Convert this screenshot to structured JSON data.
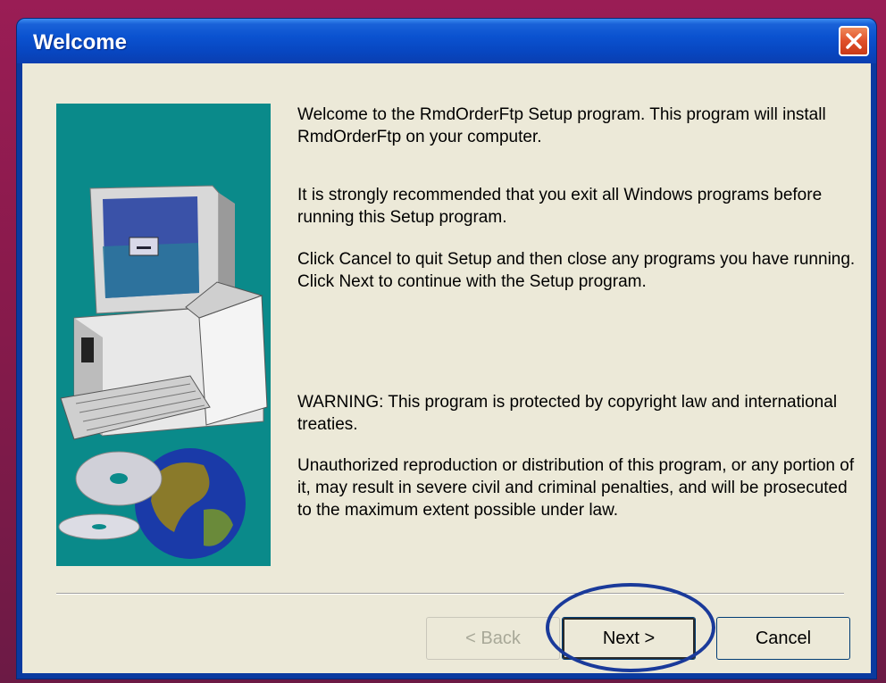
{
  "window": {
    "title": "Welcome"
  },
  "content": {
    "para1": "Welcome to the RmdOrderFtp Setup program.  This program will install RmdOrderFtp on your computer.",
    "para2": "It is strongly recommended that you exit all Windows programs before running this Setup program.",
    "para3": "Click Cancel to quit Setup and then close any programs you have running.  Click Next to continue with the Setup program.",
    "para4": "WARNING: This program is protected by copyright law and international treaties.",
    "para5": "Unauthorized reproduction or distribution of this program, or any portion of it, may result in severe civil and criminal penalties, and will be prosecuted to the maximum extent possible under law."
  },
  "buttons": {
    "back": "< Back",
    "next": "Next >",
    "cancel": "Cancel"
  },
  "colors": {
    "title_bar": "#0a52d0",
    "client_bg": "#ece9d8",
    "image_bg": "#0a8a8a",
    "close_button": "#e0502a",
    "highlight": "#1a3a9a"
  },
  "icons": {
    "close": "close-icon",
    "illustration": "computer-setup-illustration"
  }
}
